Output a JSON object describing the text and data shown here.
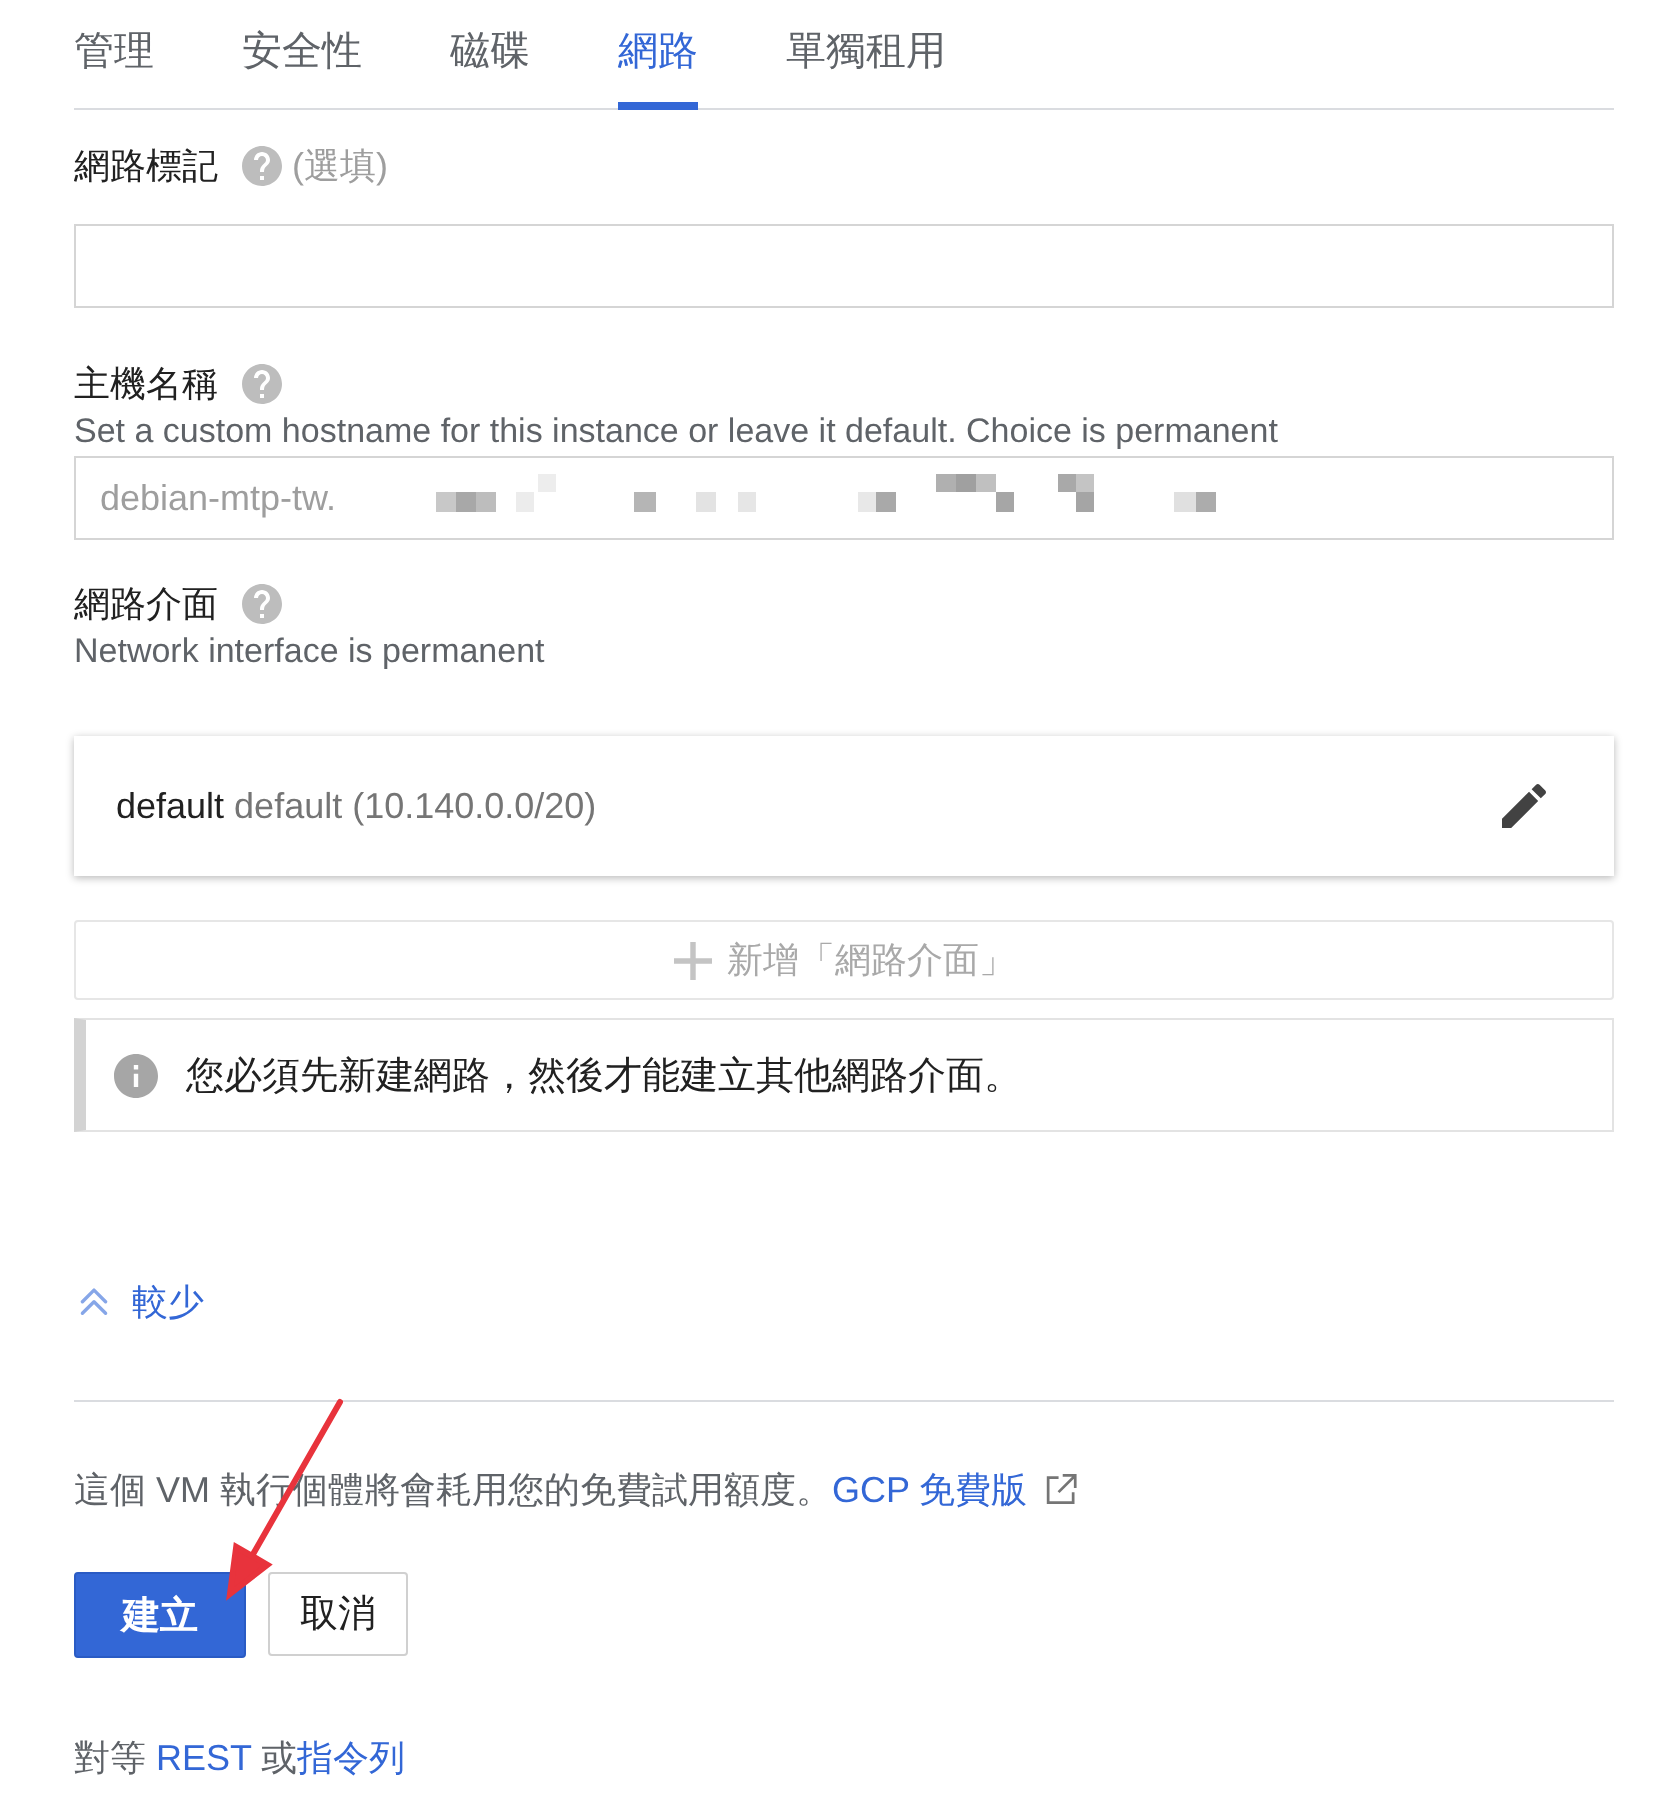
{
  "tabs": [
    {
      "label": "管理",
      "selected": false
    },
    {
      "label": "安全性",
      "selected": false
    },
    {
      "label": "磁碟",
      "selected": false
    },
    {
      "label": "網路",
      "selected": true
    },
    {
      "label": "單獨租用",
      "selected": false
    }
  ],
  "network_tags": {
    "label": "網路標記",
    "optional_note": "(選填)"
  },
  "hostname": {
    "label": "主機名稱",
    "help_text": "Set a custom hostname for this instance or leave it default. Choice is permanent",
    "placeholder": "debian-mtp-tw."
  },
  "network_interfaces": {
    "label": "網路介面",
    "help_text": "Network interface is permanent",
    "items": [
      {
        "name": "default",
        "detail": "default (10.140.0.0/20)"
      }
    ],
    "add_button": {
      "label": "新增「網路介面」",
      "disabled": true
    },
    "notice": "您必須先新建網路，然後才能建立其他網路介面。"
  },
  "less_link": "較少",
  "trial_notice": {
    "text": "這個 VM 執行個體將會耗用您的免費試用額度。",
    "link": "GCP 免費版"
  },
  "buttons": [
    {
      "label": "建立",
      "kind": "primary"
    },
    {
      "label": "取消",
      "kind": "secondary"
    }
  ],
  "equivalent": {
    "prefix": "對等",
    "rest_link": "REST",
    "joiner": "或",
    "cli_link": "指令列"
  }
}
